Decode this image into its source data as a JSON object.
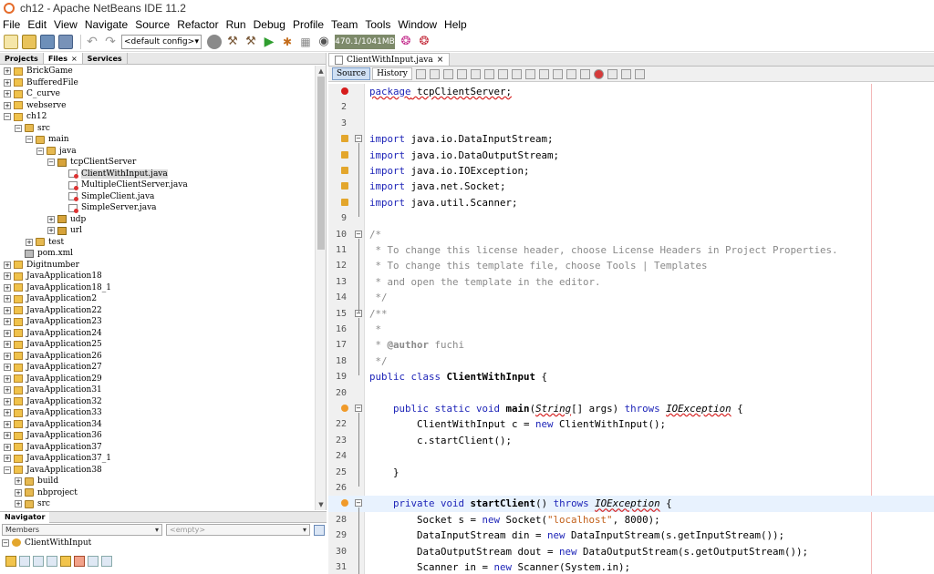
{
  "window": {
    "title": "ch12 - Apache NetBeans IDE 11.2"
  },
  "menu": [
    "File",
    "Edit",
    "View",
    "Navigate",
    "Source",
    "Refactor",
    "Run",
    "Debug",
    "Profile",
    "Team",
    "Tools",
    "Window",
    "Help"
  ],
  "toolbar": {
    "config_select": "<default config>",
    "memory": "470.1/1041MB"
  },
  "left_panel": {
    "tabs": [
      "Projects",
      "Files",
      "Services"
    ],
    "tree": [
      {
        "label": "BrickGame",
        "depth": 0,
        "exp": "+",
        "icon": "proj"
      },
      {
        "label": "BufferedFile",
        "depth": 0,
        "exp": "+",
        "icon": "proj"
      },
      {
        "label": "C_curve",
        "depth": 0,
        "exp": "+",
        "icon": "proj"
      },
      {
        "label": "webserve",
        "depth": 0,
        "exp": "+",
        "icon": "proj"
      },
      {
        "label": "ch12",
        "depth": 0,
        "exp": "-",
        "icon": "proj"
      },
      {
        "label": "src",
        "depth": 1,
        "exp": "-",
        "icon": "folder"
      },
      {
        "label": "main",
        "depth": 2,
        "exp": "-",
        "icon": "folder"
      },
      {
        "label": "java",
        "depth": 3,
        "exp": "-",
        "icon": "folder"
      },
      {
        "label": "tcpClientServer",
        "depth": 4,
        "exp": "-",
        "icon": "pkg"
      },
      {
        "label": "ClientWithInput.java",
        "depth": 5,
        "exp": "",
        "icon": "java",
        "selected": true
      },
      {
        "label": "MultipleClientServer.java",
        "depth": 5,
        "exp": "",
        "icon": "java"
      },
      {
        "label": "SimpleClient.java",
        "depth": 5,
        "exp": "",
        "icon": "java"
      },
      {
        "label": "SimpleServer.java",
        "depth": 5,
        "exp": "",
        "icon": "java"
      },
      {
        "label": "udp",
        "depth": 4,
        "exp": "+",
        "icon": "pkg"
      },
      {
        "label": "url",
        "depth": 4,
        "exp": "+",
        "icon": "pkg"
      },
      {
        "label": "test",
        "depth": 2,
        "exp": "+",
        "icon": "folder"
      },
      {
        "label": "pom.xml",
        "depth": 1,
        "exp": "",
        "icon": "pom"
      },
      {
        "label": "Digitnumber",
        "depth": 0,
        "exp": "+",
        "icon": "proj"
      },
      {
        "label": "JavaApplication18",
        "depth": 0,
        "exp": "+",
        "icon": "proj"
      },
      {
        "label": "JavaApplication18_1",
        "depth": 0,
        "exp": "+",
        "icon": "proj"
      },
      {
        "label": "JavaApplication2",
        "depth": 0,
        "exp": "+",
        "icon": "proj"
      },
      {
        "label": "JavaApplication22",
        "depth": 0,
        "exp": "+",
        "icon": "proj"
      },
      {
        "label": "JavaApplication23",
        "depth": 0,
        "exp": "+",
        "icon": "proj"
      },
      {
        "label": "JavaApplication24",
        "depth": 0,
        "exp": "+",
        "icon": "proj"
      },
      {
        "label": "JavaApplication25",
        "depth": 0,
        "exp": "+",
        "icon": "proj"
      },
      {
        "label": "JavaApplication26",
        "depth": 0,
        "exp": "+",
        "icon": "proj"
      },
      {
        "label": "JavaApplication27",
        "depth": 0,
        "exp": "+",
        "icon": "proj"
      },
      {
        "label": "JavaApplication29",
        "depth": 0,
        "exp": "+",
        "icon": "proj"
      },
      {
        "label": "JavaApplication31",
        "depth": 0,
        "exp": "+",
        "icon": "proj"
      },
      {
        "label": "JavaApplication32",
        "depth": 0,
        "exp": "+",
        "icon": "proj"
      },
      {
        "label": "JavaApplication33",
        "depth": 0,
        "exp": "+",
        "icon": "proj"
      },
      {
        "label": "JavaApplication34",
        "depth": 0,
        "exp": "+",
        "icon": "proj"
      },
      {
        "label": "JavaApplication36",
        "depth": 0,
        "exp": "+",
        "icon": "proj"
      },
      {
        "label": "JavaApplication37",
        "depth": 0,
        "exp": "+",
        "icon": "proj"
      },
      {
        "label": "JavaApplication37_1",
        "depth": 0,
        "exp": "+",
        "icon": "proj"
      },
      {
        "label": "JavaApplication38",
        "depth": 0,
        "exp": "-",
        "icon": "proj"
      },
      {
        "label": "build",
        "depth": 1,
        "exp": "+",
        "icon": "folder"
      },
      {
        "label": "nbproject",
        "depth": 1,
        "exp": "+",
        "icon": "folder"
      },
      {
        "label": "src",
        "depth": 1,
        "exp": "+",
        "icon": "folder"
      }
    ]
  },
  "navigator": {
    "tab": "Navigator",
    "members_label": "Members",
    "filter_placeholder": "<empty>",
    "item": "ClientWithInput"
  },
  "editor": {
    "tab_label": "ClientWithInput.java",
    "source_label": "Source",
    "history_label": "History",
    "lines": [
      {
        "n": "",
        "mark": "error",
        "html": "<span class=\"kw err-ul\">package</span><span class=\"err-ul\"> tcpClientServer;</span>"
      },
      {
        "n": "2",
        "html": ""
      },
      {
        "n": "3",
        "html": ""
      },
      {
        "n": "4",
        "mark": "warn",
        "fold": "-",
        "html": "<span class=\"kw\">import</span> java.io.DataInputStream;"
      },
      {
        "n": "5",
        "mark": "warn",
        "html": "<span class=\"kw\">import</span> java.io.DataOutputStream;"
      },
      {
        "n": "6",
        "mark": "warn",
        "html": "<span class=\"kw\">import</span> java.io.IOException;"
      },
      {
        "n": "7",
        "mark": "warn",
        "html": "<span class=\"kw\">import</span> java.net.Socket;"
      },
      {
        "n": "8",
        "mark": "warn",
        "html": "<span class=\"kw\">import</span> java.util.Scanner;"
      },
      {
        "n": "9",
        "html": ""
      },
      {
        "n": "10",
        "fold": "-",
        "html": "<span class=\"cm\">/*</span>"
      },
      {
        "n": "11",
        "html": "<span class=\"cm\"> * To change this license header, choose License Headers in Project Properties.</span>"
      },
      {
        "n": "12",
        "html": "<span class=\"cm\"> * To change this template file, choose Tools | Templates</span>"
      },
      {
        "n": "13",
        "html": "<span class=\"cm\"> * and open the template in the editor.</span>"
      },
      {
        "n": "14",
        "html": "<span class=\"cm\"> */</span>"
      },
      {
        "n": "15",
        "fold": "-",
        "html": "<span class=\"cm\">/**</span>"
      },
      {
        "n": "16",
        "html": "<span class=\"cm\"> *</span>"
      },
      {
        "n": "17",
        "html": "<span class=\"cm\"> * <b>@author</b> fuchi</span>"
      },
      {
        "n": "18",
        "html": "<span class=\"cm\"> */</span>"
      },
      {
        "n": "19",
        "html": "<span class=\"kw\">public class</span> <span class=\"b\">ClientWithInput</span> {"
      },
      {
        "n": "20",
        "html": ""
      },
      {
        "n": "",
        "mark": "override",
        "fold": "-",
        "html": "    <span class=\"kw\">public static void</span> <span class=\"b\">main</span>(<span class=\"ex\">String</span>[] args) <span class=\"kw\">throws</span> <span class=\"ex\">IOException</span> {"
      },
      {
        "n": "22",
        "html": "        ClientWithInput c = <span class=\"kw\">new</span> ClientWithInput();"
      },
      {
        "n": "23",
        "html": "        c.startClient();"
      },
      {
        "n": "24",
        "html": ""
      },
      {
        "n": "25",
        "html": "    }"
      },
      {
        "n": "26",
        "html": ""
      },
      {
        "n": "",
        "mark": "override",
        "fold": "-",
        "highlight": true,
        "html": "    <span class=\"kw\">private void</span> <span class=\"b\">startClient</span>() <span class=\"kw\">throws</span> <span class=\"ex\">IOException</span> {"
      },
      {
        "n": "28",
        "html": "        Socket s = <span class=\"kw\">new</span> Socket(<span class=\"str\">\"localhost\"</span>, 8000);"
      },
      {
        "n": "29",
        "html": "        DataInputStream din = <span class=\"kw\">new</span> DataInputStream(s.getInputStream());"
      },
      {
        "n": "30",
        "html": "        DataOutputStream dout = <span class=\"kw\">new</span> DataOutputStream(s.getOutputStream());"
      },
      {
        "n": "31",
        "html": "        Scanner in = <span class=\"kw\">new</span> Scanner(System.in);"
      }
    ]
  }
}
